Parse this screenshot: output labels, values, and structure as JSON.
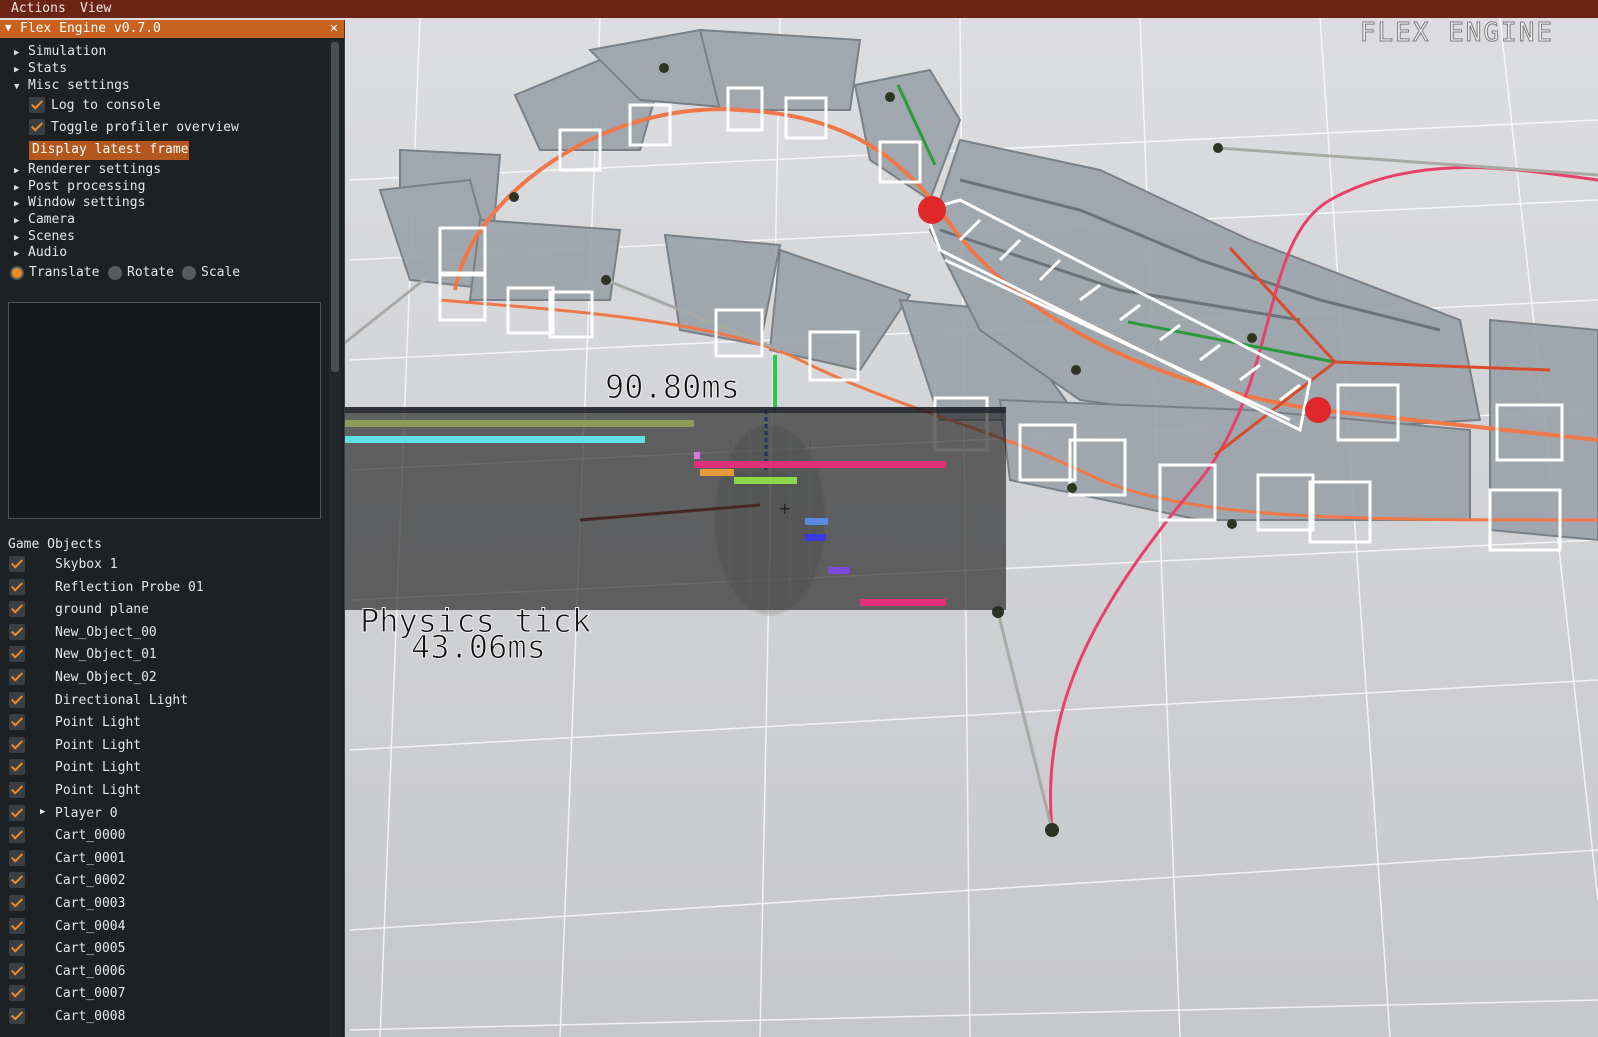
{
  "menu": {
    "items": [
      "Actions",
      "View"
    ]
  },
  "panel": {
    "title": "Flex Engine v0.7.0",
    "close_icon": "close-icon",
    "sections": [
      {
        "label": "Simulation",
        "expanded": false
      },
      {
        "label": "Stats",
        "expanded": false
      },
      {
        "label": "Misc settings",
        "expanded": true
      }
    ],
    "misc": {
      "log_to_console": "Log to console",
      "toggle_profiler": "Toggle profiler overview",
      "display_latest_frame": "Display latest frame"
    },
    "more_sections": [
      "Renderer settings",
      "Post processing",
      "Window settings",
      "Camera",
      "Scenes",
      "Audio"
    ],
    "transform": {
      "options": [
        "Translate",
        "Rotate",
        "Scale"
      ],
      "selected": "Translate"
    },
    "game_objects": {
      "header": "Game Objects",
      "items": [
        "Skybox 1",
        "Reflection Probe 01",
        "ground plane",
        "New_Object_00",
        "New_Object_01",
        "New_Object_02",
        "Directional Light",
        "Point Light",
        "Point Light",
        "Point Light",
        "Point Light",
        "Player 0",
        "Cart_0000",
        "Cart_0001",
        "Cart_0002",
        "Cart_0003",
        "Cart_0004",
        "Cart_0005",
        "Cart_0006",
        "Cart_0007",
        "Cart_0008"
      ]
    }
  },
  "viewport": {
    "brand": "FLEX ENGINE",
    "profiler": {
      "total": "90.80ms",
      "physics_label": "Physics tick",
      "physics_value": "43.06ms"
    }
  },
  "colors": {
    "accent": "#c8621e",
    "menubar": "#6b2414",
    "panel_bg": "#1d2123",
    "track": "#f07848",
    "spline": "#e8406a",
    "ground": "#cfd0d2"
  }
}
